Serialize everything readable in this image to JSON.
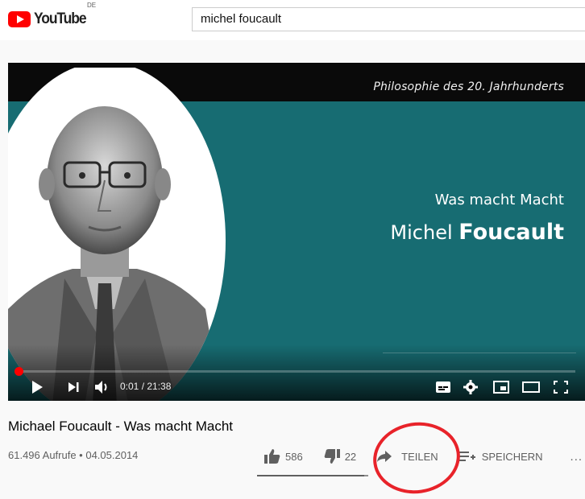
{
  "header": {
    "logo_text": "YouTube",
    "country_code": "DE",
    "search_value": "michel foucault"
  },
  "player": {
    "series_title": "Philosophie des 20. Jahrhunderts",
    "headline_line1": "Was macht Macht",
    "headline_first": "Michel",
    "headline_last": "Foucault",
    "time": "0:01 / 21:38",
    "progress_fraction": 0.0008
  },
  "video": {
    "title": "Michael Foucault - Was macht Macht",
    "views_date": "61.496 Aufrufe • 04.05.2014",
    "likes": "586",
    "dislikes": "22",
    "share_label": "TEILEN",
    "save_label": "SPEICHERN",
    "more_label": "..."
  },
  "colors": {
    "brand": "#ff0000",
    "teal": "#176c72",
    "highlight_circle": "#e8232a"
  },
  "icons": [
    "play-icon",
    "next-icon",
    "volume-icon",
    "subtitles-icon",
    "settings-icon",
    "miniplayer-icon",
    "theater-icon",
    "fullscreen-icon",
    "like-icon",
    "dislike-icon",
    "share-icon",
    "save-playlist-icon",
    "more-icon"
  ]
}
